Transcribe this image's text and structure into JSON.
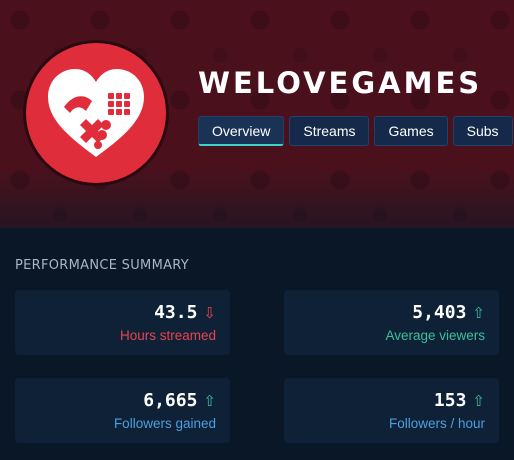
{
  "channel": {
    "name": "WELOVEGAMES",
    "logo_icon": "heart-gamepad-logo-icon"
  },
  "tabs": [
    {
      "label": "Overview",
      "active": true
    },
    {
      "label": "Streams",
      "active": false
    },
    {
      "label": "Games",
      "active": false
    },
    {
      "label": "Subs",
      "active": false
    }
  ],
  "summary": {
    "title": "PERFORMANCE SUMMARY",
    "stats": [
      {
        "value": "43.5",
        "label": "Hours streamed",
        "trend": "down",
        "arrow": "⇩",
        "color": "#e8434e"
      },
      {
        "value": "5,403",
        "label": "Average viewers",
        "trend": "up",
        "arrow": "⇧",
        "color": "#3bbf9e"
      },
      {
        "value": "6,665",
        "label": "Followers gained",
        "trend": "up",
        "arrow": "⇧",
        "color": "#4d9fe0"
      },
      {
        "value": "153",
        "label": "Followers / hour",
        "trend": "up",
        "arrow": "⇧",
        "color": "#4d9fe0"
      }
    ]
  },
  "colors": {
    "banner": "#4a111d",
    "background": "#0a1726",
    "card": "#0f2136",
    "logo_red": "#e02d3b",
    "tab_active_accent": "#3dd3c6",
    "arrow_up": "#3bbf9e",
    "arrow_down": "#e8434e"
  }
}
